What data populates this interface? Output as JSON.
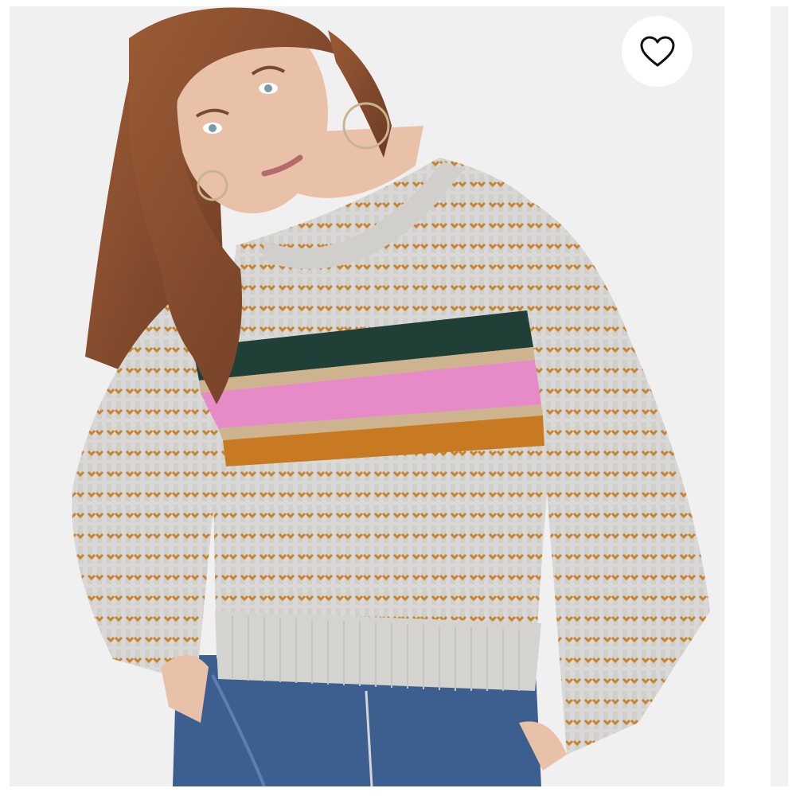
{
  "image": {
    "alt": "",
    "background_color": "#efefef"
  },
  "like_button": {
    "icon": "heart-outline-icon",
    "icon_color": "#111111",
    "background_color": "#ffffff"
  },
  "colors": {
    "sweater_base": "#d9d8d6",
    "stripe_green": "#1f3f37",
    "stripe_pink": "#e78ac8",
    "stripe_mustard": "#c77a22",
    "dot_mustard": "#c9832d",
    "jeans": "#3c5f8f",
    "hair": "#8a4f2f",
    "skin": "#e8c1a8"
  }
}
